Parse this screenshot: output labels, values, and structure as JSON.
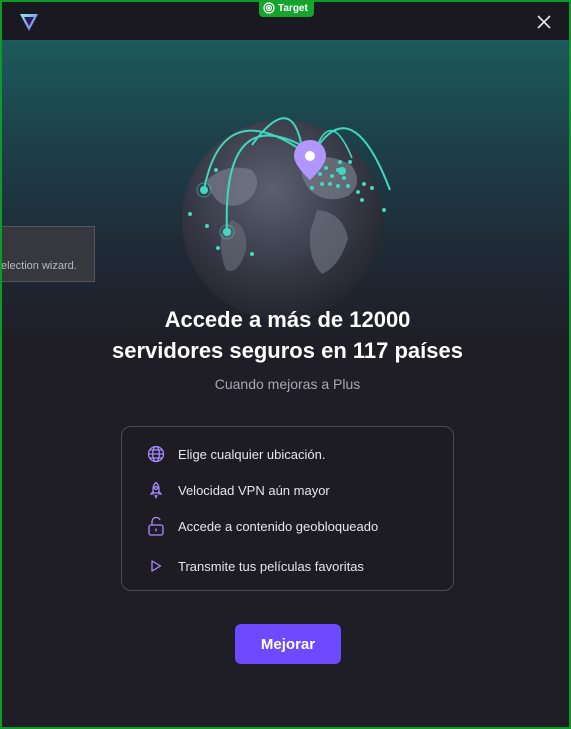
{
  "titlebar": {
    "target_badge": "Target",
    "logo_icon": "proton-vpn-logo-icon",
    "close_icon": "close-icon"
  },
  "background_tooltip": {
    "text": "election wizard."
  },
  "hero": {
    "illustration": "globe-server-map-illustration"
  },
  "headline": {
    "line1": "Accede a más de 12000",
    "line2": "servidores seguros en 117 países"
  },
  "subheadline": "Cuando mejoras a Plus",
  "features": [
    {
      "icon": "globe-icon",
      "label": "Elige cualquier ubicación."
    },
    {
      "icon": "rocket-icon",
      "label": "Velocidad VPN aún mayor"
    },
    {
      "icon": "unlock-icon",
      "label": "Accede a contenido geobloqueado"
    },
    {
      "icon": "play-icon",
      "label": "Transmite tus películas favoritas"
    }
  ],
  "cta": {
    "label": "Mejorar"
  },
  "colors": {
    "accent": "#6d4aff",
    "teal": "#3fd9c0",
    "background": "#1f1e26",
    "target_badge": "#16a42d"
  }
}
